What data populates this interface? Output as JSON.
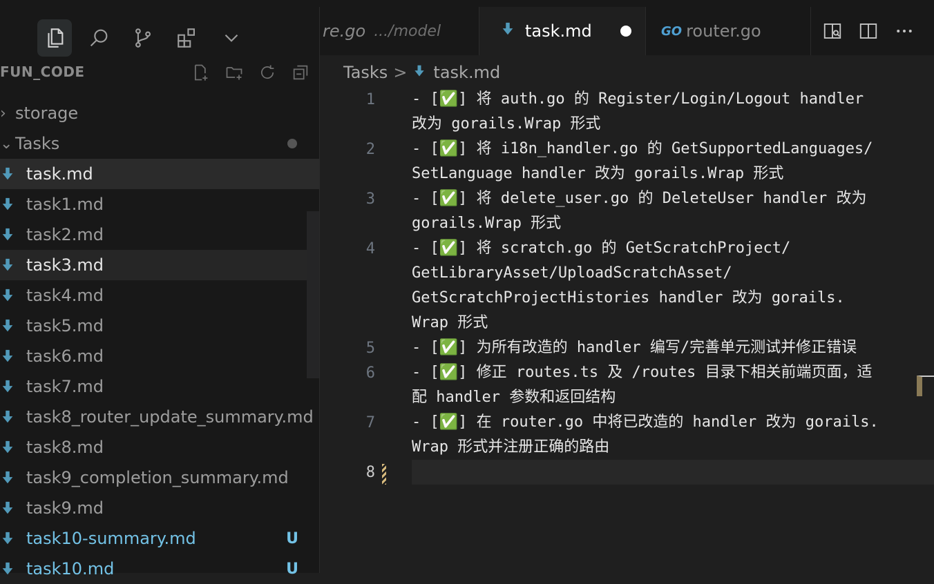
{
  "activity_bar": {
    "icons": [
      "files-icon",
      "search-icon",
      "source-control-icon",
      "extensions-icon",
      "chevron-down-icon"
    ]
  },
  "explorer": {
    "title": "FUN_CODE",
    "header_icons": [
      "new-file-icon",
      "new-folder-icon",
      "refresh-icon",
      "collapse-icon"
    ],
    "items": [
      {
        "label": "storage",
        "type": "folder",
        "expanded": false
      },
      {
        "label": "Tasks",
        "type": "folder",
        "expanded": true
      },
      {
        "label": "task.md",
        "type": "file",
        "state": "selected"
      },
      {
        "label": "task1.md",
        "type": "file"
      },
      {
        "label": "task2.md",
        "type": "file"
      },
      {
        "label": "task3.md",
        "type": "file",
        "state": "hover"
      },
      {
        "label": "task4.md",
        "type": "file"
      },
      {
        "label": "task5.md",
        "type": "file"
      },
      {
        "label": "task6.md",
        "type": "file"
      },
      {
        "label": "task7.md",
        "type": "file"
      },
      {
        "label": "task8_router_update_summary.md",
        "type": "file"
      },
      {
        "label": "task8.md",
        "type": "file"
      },
      {
        "label": "task9_completion_summary.md",
        "type": "file"
      },
      {
        "label": "task9.md",
        "type": "file"
      },
      {
        "label": "task10-summary.md",
        "type": "file",
        "badge": "U"
      },
      {
        "label": "task10.md",
        "type": "file",
        "badge": "U"
      }
    ]
  },
  "tabs": [
    {
      "label": "re.go",
      "desc": ".../model",
      "state": "inactive"
    },
    {
      "label": "task.md",
      "state": "active",
      "modified": true
    },
    {
      "label": "router.go",
      "state": "inactive",
      "logo": "GO"
    }
  ],
  "breadcrumb": {
    "folder": "Tasks",
    "file": "task.md",
    "separator": ">"
  },
  "editor": {
    "lines": [
      {
        "num": "1",
        "rows": [
          "- [✅] 将 auth.go 的 Register/Login/Logout handler",
          "改为 gorails.Wrap 形式"
        ]
      },
      {
        "num": "2",
        "rows": [
          "- [✅] 将 i18n_handler.go 的 GetSupportedLanguages/",
          "SetLanguage handler 改为 gorails.Wrap 形式"
        ]
      },
      {
        "num": "3",
        "rows": [
          "- [✅] 将 delete_user.go 的 DeleteUser handler 改为",
          "gorails.Wrap 形式"
        ]
      },
      {
        "num": "4",
        "rows": [
          "- [✅] 将 scratch.go 的 GetScratchProject/",
          "GetLibraryAsset/UploadScratchAsset/",
          "GetScratchProjectHistories handler 改为 gorails.",
          "Wrap 形式"
        ]
      },
      {
        "num": "5",
        "rows": [
          "- [✅] 为所有改造的 handler 编写/完善单元测试并修正错误"
        ]
      },
      {
        "num": "6",
        "rows": [
          "- [✅] 修正 routes.ts 及 /routes 目录下相关前端页面，适",
          "配 handler 参数和返回结构"
        ]
      },
      {
        "num": "7",
        "rows": [
          "- [✅] 在 router.go 中将已改造的 handler 改为 gorails.",
          "Wrap 形式并注册正确的路由"
        ]
      },
      {
        "num": "8",
        "rows": [
          ""
        ]
      }
    ]
  }
}
